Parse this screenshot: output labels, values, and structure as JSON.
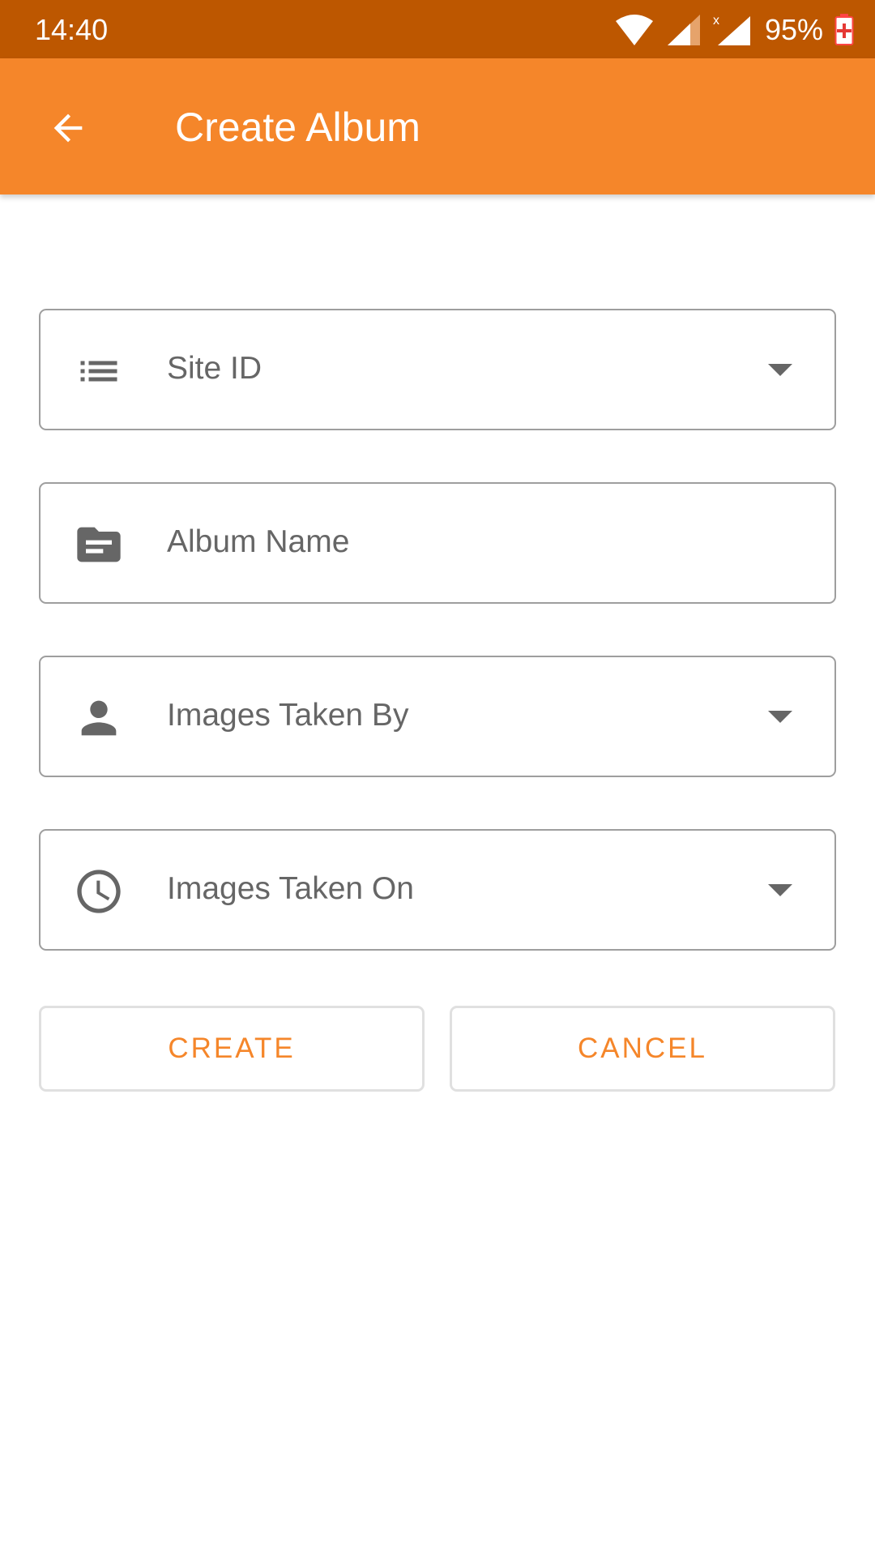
{
  "status_bar": {
    "time": "14:40",
    "battery_percent": "95%",
    "icons": [
      "wifi-icon",
      "signal-icon",
      "signal-no-data-icon",
      "battery-charging-icon"
    ]
  },
  "app_bar": {
    "title": "Create Album",
    "back_icon": "arrow-back-icon"
  },
  "form": {
    "fields": [
      {
        "label": "Site ID",
        "icon": "list-icon",
        "type": "dropdown"
      },
      {
        "label": "Album Name",
        "icon": "folder-icon",
        "type": "text"
      },
      {
        "label": "Images Taken By",
        "icon": "person-icon",
        "type": "dropdown"
      },
      {
        "label": "Images Taken On",
        "icon": "clock-icon",
        "type": "dropdown"
      }
    ]
  },
  "buttons": {
    "create_label": "CREATE",
    "cancel_label": "CANCEL"
  },
  "colors": {
    "status_bar": "#BD5700",
    "app_bar": "#F5862A",
    "accent": "#F5862A",
    "icon_gray": "#666666"
  }
}
